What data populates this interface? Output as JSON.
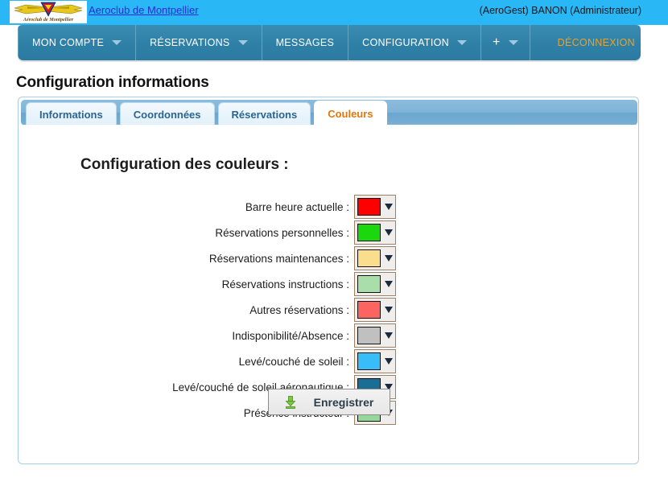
{
  "header": {
    "logo_alt": "Aeroclub de Montpellier",
    "site_link": "Aeroclub de Montpellier",
    "user_info": "(AeroGest) BANON (Administrateur)"
  },
  "nav": {
    "items": [
      {
        "label": "MON COMPTE",
        "has_caret": true
      },
      {
        "label": "RÉSERVATIONS",
        "has_caret": true
      },
      {
        "label": "MESSAGES",
        "has_caret": false
      },
      {
        "label": "CONFIGURATION",
        "has_caret": true
      },
      {
        "label": "+",
        "has_caret": true
      }
    ],
    "logout_label": "DÉCONNEXION"
  },
  "page": {
    "title": "Configuration informations"
  },
  "tabs": [
    {
      "label": "Informations",
      "active": false
    },
    {
      "label": "Coordonnées",
      "active": false
    },
    {
      "label": "Réservations",
      "active": false
    },
    {
      "label": "Couleurs",
      "active": true
    }
  ],
  "form": {
    "title": "Configuration des couleurs :",
    "rows": [
      {
        "label": "Barre heure actuelle :",
        "color": "#fe0000"
      },
      {
        "label": "Réservations personnelles :",
        "color": "#1bd70d"
      },
      {
        "label": "Réservations maintenances :",
        "color": "#fade8d"
      },
      {
        "label": "Réservations instructions :",
        "color": "#a9dda9"
      },
      {
        "label": "Autres réservations :",
        "color": "#fb6460"
      },
      {
        "label": "Indisponibilité/Absence :",
        "color": "#c0c0c0"
      },
      {
        "label": "Levé/couché de soleil :",
        "color": "#38bdf8"
      },
      {
        "label": "Levé/couché de soleil aéronautique :",
        "color": "#1a6e96"
      },
      {
        "label": "Présence instructeur :",
        "color": "#96d89a"
      }
    ],
    "save_label": "Enregistrer"
  },
  "colors": {
    "header_band": "#29b8f5",
    "navbar": "#2f80a7",
    "logout_text": "#f0a020",
    "active_tab_text": "#e2760c",
    "tab_text": "#2b6590",
    "link": "#2a2ad0"
  }
}
